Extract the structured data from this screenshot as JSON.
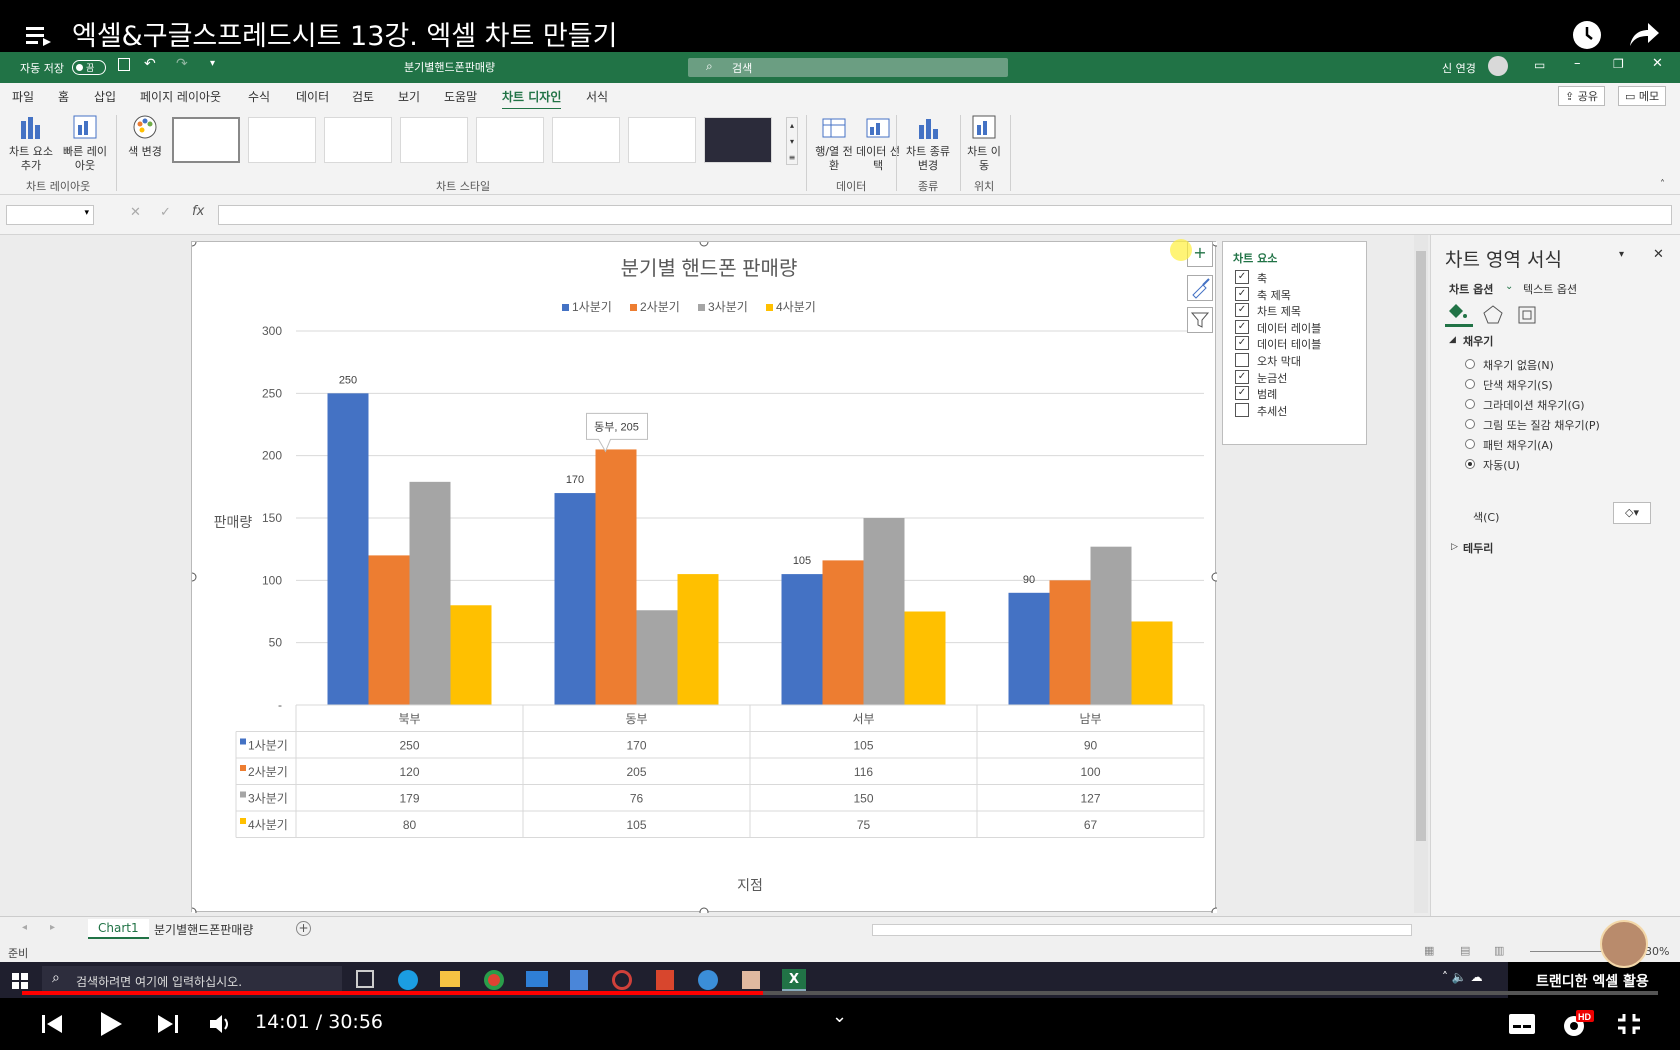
{
  "video": {
    "title": "엑셀&구글스프레드시트 13강. 엑셀 차트 만들기",
    "time": "14:01 / 30:56",
    "progress_fraction": 0.453,
    "channel_overlay": "트랜디한 엑셀 활용"
  },
  "excel": {
    "autosave_label": "자동 저장",
    "autosave_state": "끔",
    "file_name": "분기별핸드폰판매량",
    "search_placeholder": "검색",
    "user_name": "신 연경",
    "tabs": [
      "파일",
      "홈",
      "삽입",
      "페이지 레이아웃",
      "수식",
      "데이터",
      "검토",
      "보기",
      "도움말",
      "차트 디자인",
      "서식"
    ],
    "active_tab": "차트 디자인",
    "share_label": "공유",
    "memo_label": "메모",
    "ribbon": {
      "add_element": "차트 요소 추가",
      "quick_layout": "빠른 레이아웃",
      "change_color": "색 변경",
      "switch_rowcol": "행/열 전환",
      "select_data": "데이터 선택",
      "change_type": "차트 종류 변경",
      "move_chart": "차트 이동",
      "group_layout": "차트 레이아웃",
      "group_styles": "차트 스타일",
      "group_data": "데이터",
      "group_type": "종류",
      "group_location": "위치"
    },
    "sheet_tabs": [
      "Chart1",
      "분기별핸드폰판매량"
    ],
    "status": "준비",
    "zoom": "130%"
  },
  "chart_elements_panel": {
    "title": "차트 요소",
    "items": [
      {
        "label": "축",
        "checked": true
      },
      {
        "label": "축 제목",
        "checked": true
      },
      {
        "label": "차트 제목",
        "checked": true
      },
      {
        "label": "데이터 레이블",
        "checked": true
      },
      {
        "label": "데이터 테이블",
        "checked": true
      },
      {
        "label": "오차 막대",
        "checked": false
      },
      {
        "label": "눈금선",
        "checked": true
      },
      {
        "label": "범례",
        "checked": true
      },
      {
        "label": "추세선",
        "checked": false
      }
    ]
  },
  "format_pane": {
    "title": "차트 영역 서식",
    "tab1": "차트 옵션",
    "tab2": "텍스트 옵션",
    "fill_section": "채우기",
    "fill_options": [
      "채우기 없음(N)",
      "단색 채우기(S)",
      "그라데이션 채우기(G)",
      "그림 또는 질감 채우기(P)",
      "패턴 채우기(A)",
      "자동(U)"
    ],
    "selected_fill": "자동(U)",
    "color_label": "색(C)",
    "border_section": "테두리"
  },
  "taskbar": {
    "search_placeholder": "검색하려면 여기에 입력하십시오."
  },
  "chart_data": {
    "type": "bar",
    "title": "분기별 핸드폰 판매량",
    "xlabel": "지점",
    "ylabel": "판매량",
    "categories": [
      "북부",
      "동부",
      "서부",
      "남부"
    ],
    "series": [
      {
        "name": "1사분기",
        "values": [
          250,
          170,
          105,
          90
        ],
        "color": "#4472c4"
      },
      {
        "name": "2사분기",
        "values": [
          120,
          205,
          116,
          100
        ],
        "color": "#ed7d31"
      },
      {
        "name": "3사분기",
        "values": [
          179,
          76,
          150,
          127
        ],
        "color": "#a5a5a5"
      },
      {
        "name": "4사분기",
        "values": [
          80,
          105,
          75,
          67
        ],
        "color": "#ffc000"
      }
    ],
    "ylim": [
      0,
      300
    ],
    "yticks": [
      "-",
      "50",
      "100",
      "150",
      "200",
      "250",
      "300"
    ],
    "data_labels_shown_series": "1사분기",
    "callout": "동부, 205",
    "legend_position": "top",
    "grid": true,
    "data_table": true
  }
}
